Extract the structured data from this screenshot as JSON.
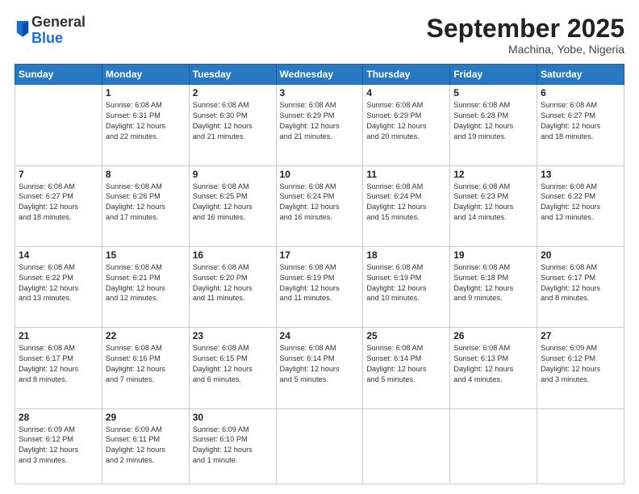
{
  "header": {
    "logo_general": "General",
    "logo_blue": "Blue",
    "month_title": "September 2025",
    "location": "Machina, Yobe, Nigeria"
  },
  "days_of_week": [
    "Sunday",
    "Monday",
    "Tuesday",
    "Wednesday",
    "Thursday",
    "Friday",
    "Saturday"
  ],
  "weeks": [
    [
      {
        "day": "",
        "info": ""
      },
      {
        "day": "1",
        "info": "Sunrise: 6:08 AM\nSunset: 6:31 PM\nDaylight: 12 hours\nand 22 minutes."
      },
      {
        "day": "2",
        "info": "Sunrise: 6:08 AM\nSunset: 6:30 PM\nDaylight: 12 hours\nand 21 minutes."
      },
      {
        "day": "3",
        "info": "Sunrise: 6:08 AM\nSunset: 6:29 PM\nDaylight: 12 hours\nand 21 minutes."
      },
      {
        "day": "4",
        "info": "Sunrise: 6:08 AM\nSunset: 6:29 PM\nDaylight: 12 hours\nand 20 minutes."
      },
      {
        "day": "5",
        "info": "Sunrise: 6:08 AM\nSunset: 6:28 PM\nDaylight: 12 hours\nand 19 minutes."
      },
      {
        "day": "6",
        "info": "Sunrise: 6:08 AM\nSunset: 6:27 PM\nDaylight: 12 hours\nand 18 minutes."
      }
    ],
    [
      {
        "day": "7",
        "info": "Sunrise: 6:08 AM\nSunset: 6:27 PM\nDaylight: 12 hours\nand 18 minutes."
      },
      {
        "day": "8",
        "info": "Sunrise: 6:08 AM\nSunset: 6:26 PM\nDaylight: 12 hours\nand 17 minutes."
      },
      {
        "day": "9",
        "info": "Sunrise: 6:08 AM\nSunset: 6:25 PM\nDaylight: 12 hours\nand 16 minutes."
      },
      {
        "day": "10",
        "info": "Sunrise: 6:08 AM\nSunset: 6:24 PM\nDaylight: 12 hours\nand 16 minutes."
      },
      {
        "day": "11",
        "info": "Sunrise: 6:08 AM\nSunset: 6:24 PM\nDaylight: 12 hours\nand 15 minutes."
      },
      {
        "day": "12",
        "info": "Sunrise: 6:08 AM\nSunset: 6:23 PM\nDaylight: 12 hours\nand 14 minutes."
      },
      {
        "day": "13",
        "info": "Sunrise: 6:08 AM\nSunset: 6:22 PM\nDaylight: 12 hours\nand 13 minutes."
      }
    ],
    [
      {
        "day": "14",
        "info": "Sunrise: 6:08 AM\nSunset: 6:22 PM\nDaylight: 12 hours\nand 13 minutes."
      },
      {
        "day": "15",
        "info": "Sunrise: 6:08 AM\nSunset: 6:21 PM\nDaylight: 12 hours\nand 12 minutes."
      },
      {
        "day": "16",
        "info": "Sunrise: 6:08 AM\nSunset: 6:20 PM\nDaylight: 12 hours\nand 11 minutes."
      },
      {
        "day": "17",
        "info": "Sunrise: 6:08 AM\nSunset: 6:19 PM\nDaylight: 12 hours\nand 11 minutes."
      },
      {
        "day": "18",
        "info": "Sunrise: 6:08 AM\nSunset: 6:19 PM\nDaylight: 12 hours\nand 10 minutes."
      },
      {
        "day": "19",
        "info": "Sunrise: 6:08 AM\nSunset: 6:18 PM\nDaylight: 12 hours\nand 9 minutes."
      },
      {
        "day": "20",
        "info": "Sunrise: 6:08 AM\nSunset: 6:17 PM\nDaylight: 12 hours\nand 8 minutes."
      }
    ],
    [
      {
        "day": "21",
        "info": "Sunrise: 6:08 AM\nSunset: 6:17 PM\nDaylight: 12 hours\nand 8 minutes."
      },
      {
        "day": "22",
        "info": "Sunrise: 6:08 AM\nSunset: 6:16 PM\nDaylight: 12 hours\nand 7 minutes."
      },
      {
        "day": "23",
        "info": "Sunrise: 6:08 AM\nSunset: 6:15 PM\nDaylight: 12 hours\nand 6 minutes."
      },
      {
        "day": "24",
        "info": "Sunrise: 6:08 AM\nSunset: 6:14 PM\nDaylight: 12 hours\nand 5 minutes."
      },
      {
        "day": "25",
        "info": "Sunrise: 6:08 AM\nSunset: 6:14 PM\nDaylight: 12 hours\nand 5 minutes."
      },
      {
        "day": "26",
        "info": "Sunrise: 6:08 AM\nSunset: 6:13 PM\nDaylight: 12 hours\nand 4 minutes."
      },
      {
        "day": "27",
        "info": "Sunrise: 6:09 AM\nSunset: 6:12 PM\nDaylight: 12 hours\nand 3 minutes."
      }
    ],
    [
      {
        "day": "28",
        "info": "Sunrise: 6:09 AM\nSunset: 6:12 PM\nDaylight: 12 hours\nand 3 minutes."
      },
      {
        "day": "29",
        "info": "Sunrise: 6:09 AM\nSunset: 6:11 PM\nDaylight: 12 hours\nand 2 minutes."
      },
      {
        "day": "30",
        "info": "Sunrise: 6:09 AM\nSunset: 6:10 PM\nDaylight: 12 hours\nand 1 minute."
      },
      {
        "day": "",
        "info": ""
      },
      {
        "day": "",
        "info": ""
      },
      {
        "day": "",
        "info": ""
      },
      {
        "day": "",
        "info": ""
      }
    ]
  ]
}
